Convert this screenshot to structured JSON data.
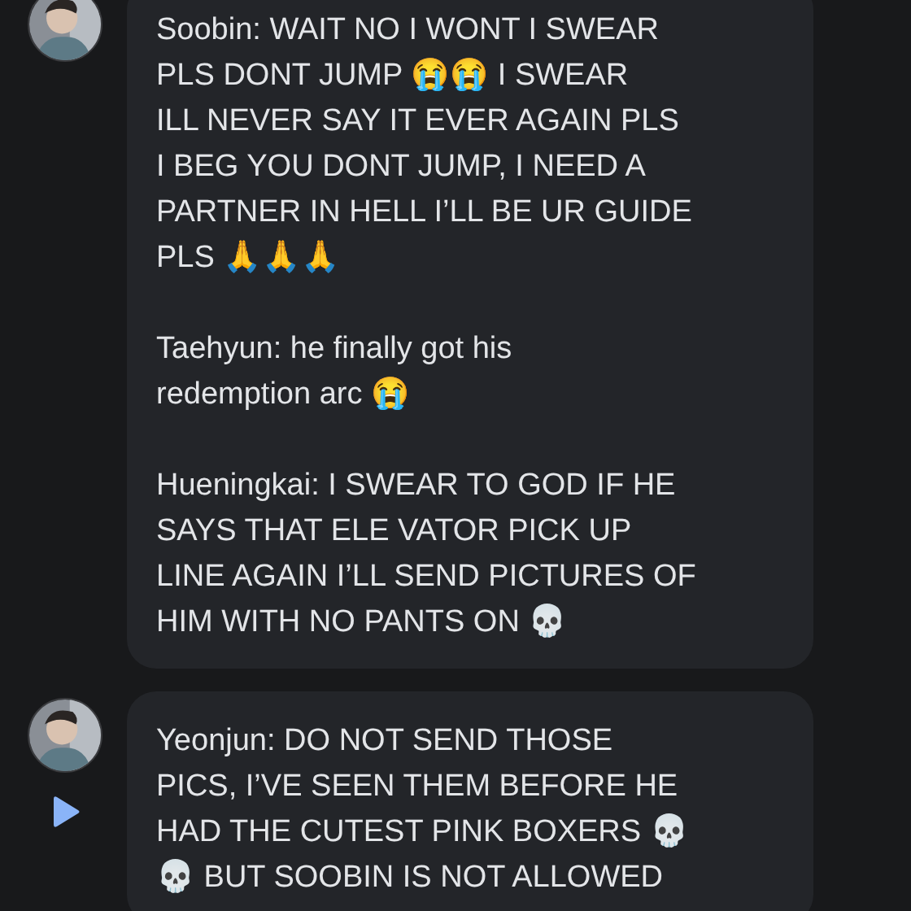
{
  "messages": [
    {
      "avatar": {
        "kind": "picture"
      },
      "play_button": false,
      "paragraphs": [
        {
          "lines": [
            "Soobin: WAIT NO I WONT I SWEAR",
            "PLS DONT JUMP 😭😭 I SWEAR",
            "ILL NEVER SAY IT EVER AGAIN PLS",
            "I BEG YOU DONT JUMP, I NEED A",
            "PARTNER IN HELL I’LL BE UR GUIDE",
            "PLS 🙏🙏🙏"
          ]
        },
        {
          "lines": [
            "Taehyun: he finally got his",
            "redemption arc 😭"
          ]
        },
        {
          "lines": [
            "Hueningkai: I SWEAR TO GOD IF HE",
            "SAYS THAT ELE VATOR PICK UP",
            "LINE AGAIN I’LL SEND PICTURES OF",
            "HIM WITH NO PANTS ON 💀"
          ]
        }
      ]
    },
    {
      "avatar": {
        "kind": "picture"
      },
      "play_button": true,
      "paragraphs": [
        {
          "lines": [
            "Yeonjun: DO NOT SEND THOSE",
            "PICS, I’VE SEEN THEM BEFORE HE",
            "HAD THE CUTEST PINK BOXERS 💀",
            "💀 BUT SOOBIN IS NOT ALLOWED"
          ]
        }
      ]
    }
  ]
}
